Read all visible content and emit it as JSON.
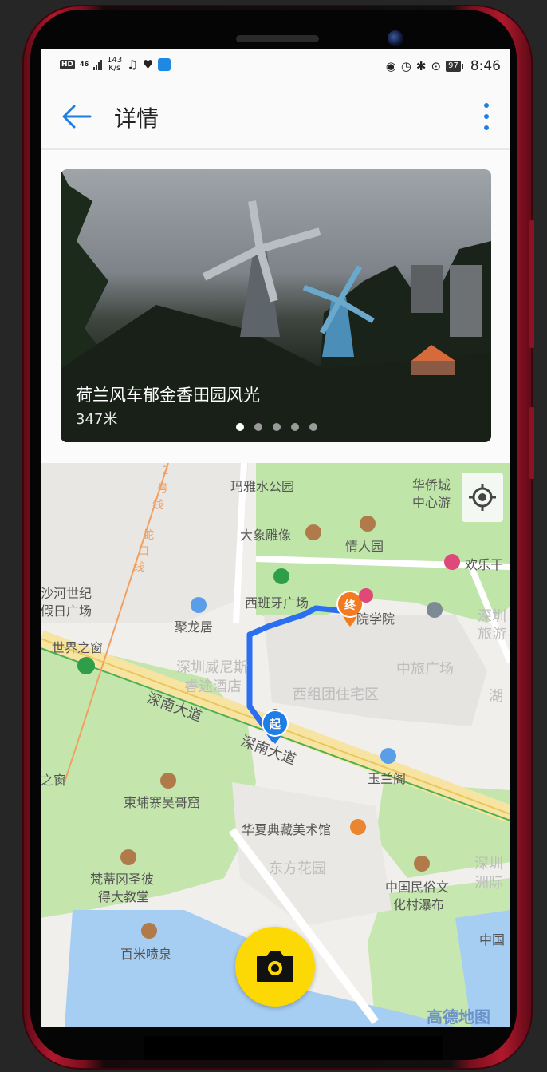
{
  "status_bar": {
    "hd": "HD",
    "network": "46",
    "speed_value": "143",
    "speed_unit": "K/s",
    "icons_left": [
      "music-icon",
      "health-heart-icon",
      "app-icon"
    ],
    "icons_right": [
      "eye-icon",
      "alarm-icon",
      "bluetooth-icon",
      "location-icon"
    ],
    "battery": "97",
    "time": "8:46"
  },
  "app_bar": {
    "title": "详情"
  },
  "photo_card": {
    "title": "荷兰风车郁金香田园风光",
    "distance": "347米",
    "page_count": 5,
    "active_page": 0
  },
  "map": {
    "labels": {
      "maya_park": "玛雅水公园",
      "huaqiao": "华侨城",
      "huaqiao_sub": "中心游",
      "elephant": "大象雕像",
      "lover_garden": "情人园",
      "happy_valley": "欢乐干",
      "shahe_1": "沙河世纪",
      "shahe_2": "假日广场",
      "spain_square": "西班牙广场",
      "academy": "院学院",
      "julongju": "聚龙居",
      "window_world": "世界之窗",
      "venice_1": "深圳威尼斯",
      "venice_2": "睿途酒店",
      "xizu": "西组团住宅区",
      "zhonglv": "中旅广场",
      "shennan_left": "深南大道",
      "shennan_right": "深南大道",
      "yulange": "玉兰阁",
      "lake": "湖",
      "sz_travel_1": "深圳",
      "sz_travel_2": "旅游",
      "window_edge": "之窗",
      "cambodia": "柬埔寨吴哥窟",
      "huaxia": "华夏典藏美术馆",
      "dongfang": "东方花园",
      "vatican_1": "梵蒂冈圣彼",
      "vatican_2": "得大教堂",
      "folk_1": "中国民俗文",
      "folk_2": "化村瀑布",
      "sz_right_1": "深圳",
      "sz_right_2": "洲际",
      "china": "中国",
      "fountain": "百米喷泉",
      "line2_1": "2",
      "line2_2": "号",
      "line2_3": "线",
      "line2_4": "蛇",
      "line2_5": "口",
      "line2_6": "线"
    },
    "start_marker": "起",
    "end_marker": "终",
    "logo": "高德地图",
    "route_color": "#2b6ff0",
    "start_color": "#1f7de6",
    "end_color": "#f47a21"
  },
  "colors": {
    "accent": "#1e7fe0",
    "fab": "#fcd804",
    "park_green": "#bfe5a8",
    "water": "#a6cdf2",
    "road_yellow": "#f7e4a2"
  }
}
